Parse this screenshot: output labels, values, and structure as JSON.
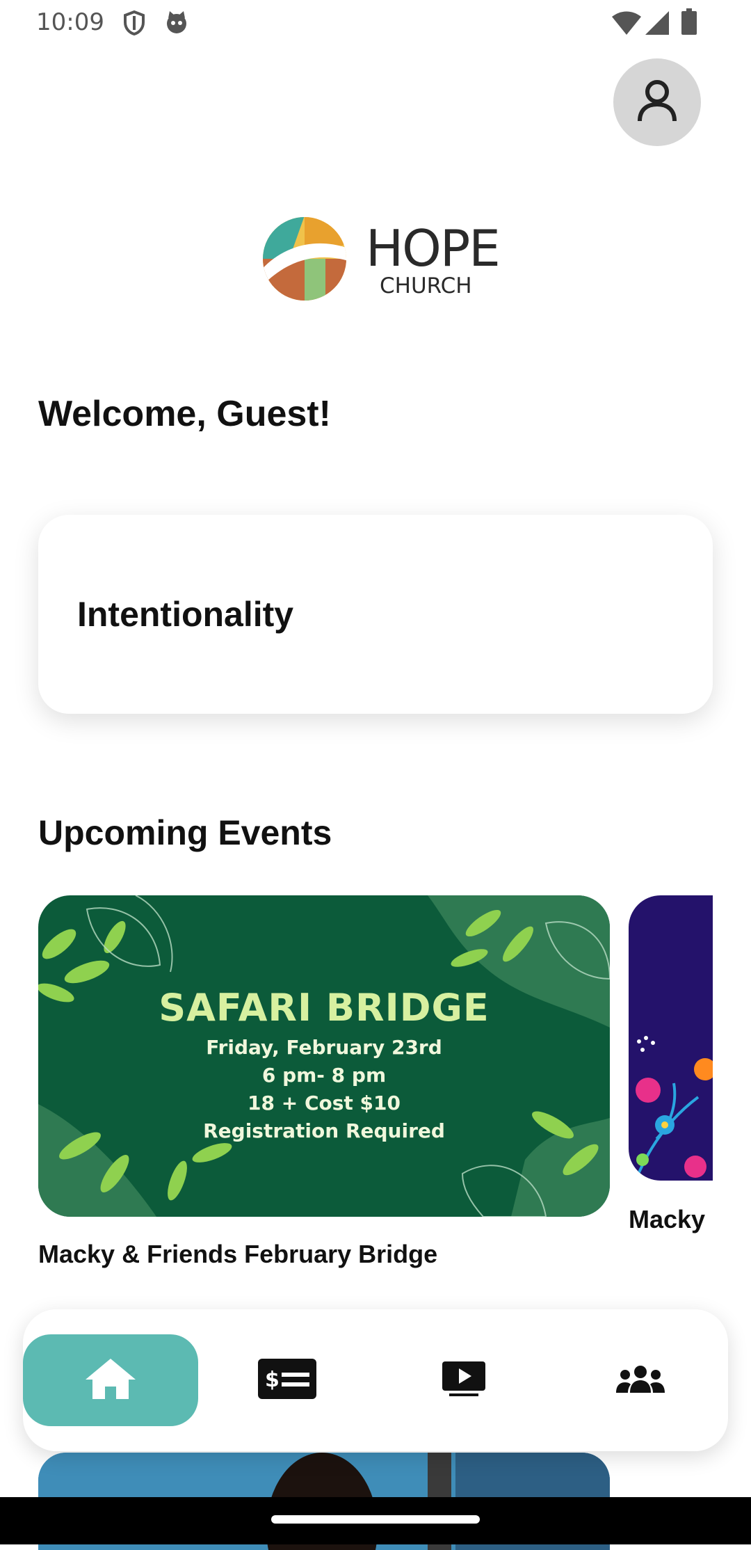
{
  "status_bar": {
    "time": "10:09",
    "left_icons": [
      "shield-icon",
      "cat-icon"
    ],
    "right_icons": [
      "wifi-icon",
      "signal-icon",
      "battery-icon"
    ]
  },
  "header": {
    "profile_icon": "person-icon"
  },
  "logo": {
    "primary": "HOPE",
    "secondary": "CHURCH"
  },
  "welcome": {
    "text": "Welcome, Guest!"
  },
  "highlight_card": {
    "title": "Intentionality"
  },
  "upcoming_events": {
    "title": "Upcoming Events",
    "events": [
      {
        "caption": "Macky & Friends February Bridge",
        "flyer": {
          "headline": "SAFARI BRIDGE",
          "lines": [
            "Friday, February 23rd",
            "6 pm- 8 pm",
            "18 +  Cost $10",
            "Registration Required"
          ]
        }
      },
      {
        "caption": "Macky"
      }
    ]
  },
  "bottom_nav": {
    "items": [
      {
        "icon": "home-icon",
        "active": true
      },
      {
        "icon": "giving-card-icon",
        "active": false
      },
      {
        "icon": "video-play-icon",
        "active": false
      },
      {
        "icon": "people-group-icon",
        "active": false
      }
    ]
  },
  "colors": {
    "accent": "#5cbab2",
    "flyer_green": "#0c5b3a",
    "flyer_purple": "#24126b",
    "profile_bg": "#d6d6d6"
  }
}
